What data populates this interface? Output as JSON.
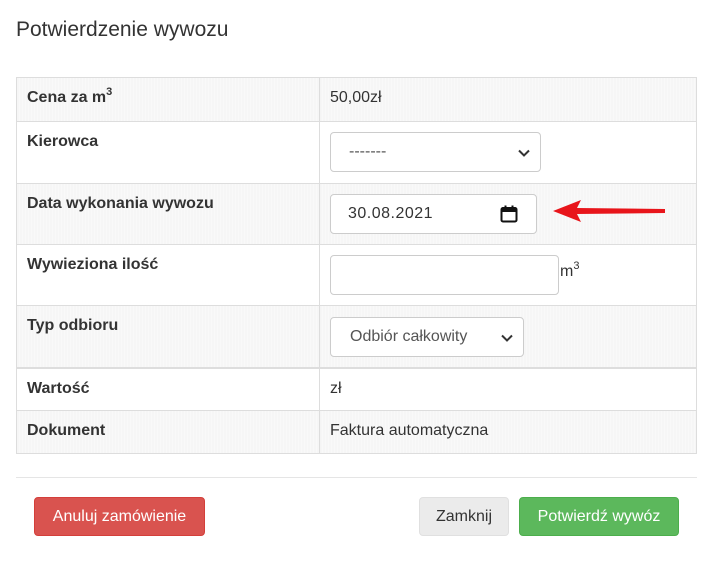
{
  "dialog": {
    "title": "Potwierdzenie wywozu"
  },
  "table": {
    "price_label": "Cena za m",
    "price_label_sup": "3",
    "price_value": "50,00zł",
    "driver_label": "Kierowca",
    "driver_selected": "-------",
    "date_label": "Data wykonania wywozu",
    "date_value": "30.08.2021",
    "quantity_label": "Wywieziona ilość",
    "quantity_value": "",
    "quantity_unit": "m",
    "quantity_unit_sup": "3",
    "pickup_type_label": "Typ odbioru",
    "pickup_type_selected": "Odbiór całkowity",
    "value_label": "Wartość",
    "value_value": "zł",
    "document_label": "Dokument",
    "document_value": "Faktura automatyczna"
  },
  "footer": {
    "cancel_order_label": "Anuluj zamówienie",
    "close_label": "Zamknij",
    "confirm_label": "Potwierdź wywóz"
  },
  "colors": {
    "danger": "#d9534f",
    "success": "#5cb85c",
    "default_button": "#ebebeb",
    "annotation_arrow": "#e8151b"
  },
  "icons": {
    "driver_select": "chevron-down-icon",
    "date_input": "calendar-icon",
    "pickup_type_select": "chevron-down-icon",
    "annotation": "red-arrow-icon"
  }
}
